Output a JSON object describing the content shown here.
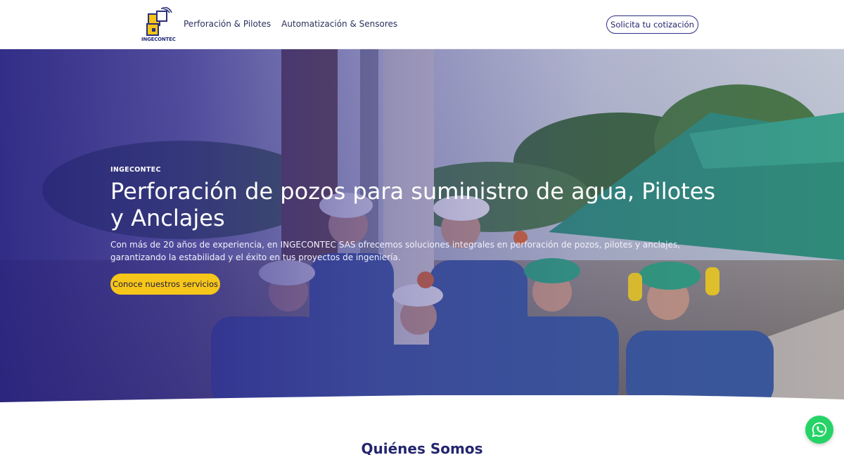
{
  "brand": {
    "name": "INGECONTEC"
  },
  "nav": {
    "items": [
      {
        "label": "Perforación & Pilotes"
      },
      {
        "label": "Automatización & Sensores"
      }
    ],
    "cta_label": "Solicita tu cotización"
  },
  "hero": {
    "eyebrow": "INGECONTEC",
    "title": "Perforación de pozos para suministro de agua, Pilotes y Anclajes",
    "description": "Con más de 20 años de experiencia, en INGECONTEC SAS ofrecemos soluciones integrales en perforación de pozos, pilotes y anclajes, garantizando la estabilidad y el éxito en tus proyectos de ingeniería.",
    "button_label": "Conoce nuestros servicios"
  },
  "about": {
    "title": "Quiénes Somos"
  },
  "floating": {
    "icon": "whatsapp-icon"
  },
  "colors": {
    "primary": "#2e2f8a",
    "accent": "#f7c61a",
    "whatsapp": "#25d366"
  }
}
